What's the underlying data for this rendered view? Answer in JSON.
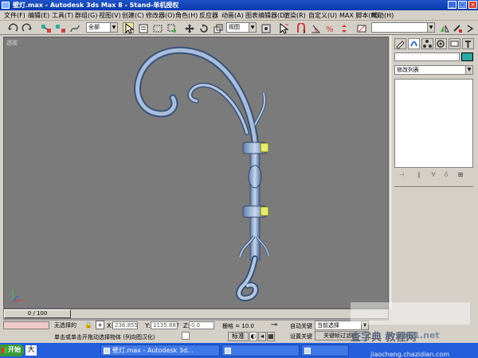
{
  "window": {
    "title": "壁灯.max - Autodesk 3ds Max 8 - Stand-单机授权"
  },
  "menu": [
    "文件(F)",
    "编辑(E)",
    "工具(T)",
    "群组(G)",
    "视图(V)",
    "创建(C)",
    "修改器(O)",
    "角色(H)",
    "反应器",
    "动画(A)",
    "图表编辑器(D)",
    "渲染(R)",
    "自定义(U)",
    "MAX 脚本(M)",
    "帮助(H)"
  ],
  "toolbar": {
    "selection_filter": "全部",
    "ref_coord": "视图",
    "named_selection": ""
  },
  "viewport": {
    "label": "透视"
  },
  "command_panel": {
    "modifier_list": "修改列表",
    "swatch_color": "#2aa7a7"
  },
  "timeslider": {
    "frame": "0 / 100"
  },
  "status": {
    "selection": "无选择的",
    "x_label": "X:",
    "x_value": "236.855",
    "y_label": "Y:",
    "y_value": "1135.887",
    "z_label": "Z:",
    "z_value": "0.0",
    "grid": "栅格 = 10.0",
    "prompt": "单击或单击开拖动选择物体 (列向图汉化)",
    "auto_key": "自动关键",
    "set_key": "设置关键",
    "selection_set": "当前选择",
    "key_filters": "关键帧过滤器"
  },
  "taskbar": {
    "start": "开始",
    "ime": "大",
    "tasks": [
      "壁灯.max - Autodesk 3d...",
      "",
      ""
    ]
  },
  "watermark": {
    "line1": "jb51.net",
    "line2": "查字典 教程网",
    "line3": "jiaocheng.chazidian.com"
  }
}
